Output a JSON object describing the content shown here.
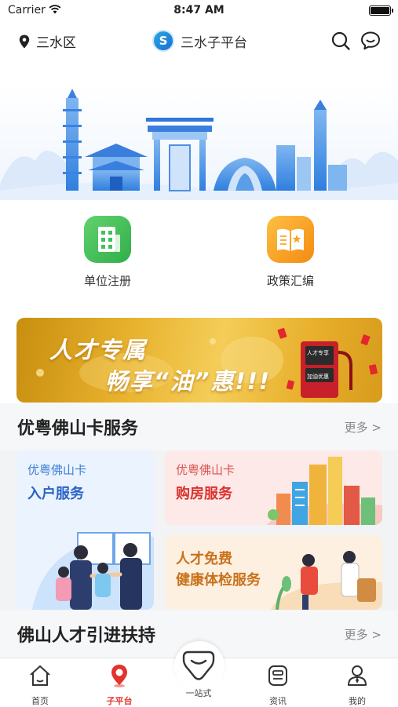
{
  "status_bar": {
    "carrier": "Carrier",
    "time": "8:47 AM"
  },
  "nav": {
    "location": "三水区",
    "platform_title": "三水子平台",
    "platform_logo_glyph": "S"
  },
  "entries": [
    {
      "label": "单位注册",
      "icon": "building-icon",
      "color": "#3ec15a"
    },
    {
      "label": "政策汇编",
      "icon": "book-icon",
      "color": "#f7a21e"
    }
  ],
  "promo": {
    "line1": "人才专属",
    "line2": "畅享“油”惠!!!",
    "sign_line1": "人才专享",
    "sign_line2": "加油优惠"
  },
  "section1": {
    "title": "优粤佛山卡服务",
    "more": "更多 >",
    "cards": [
      {
        "sub": "优粤佛山卡",
        "main": "入户服务",
        "color": "#2a64c5"
      },
      {
        "sub": "优粤佛山卡",
        "main": "购房服务",
        "color": "#d9322f"
      },
      {
        "line1": "人才免费",
        "line2": "健康体检服务",
        "color": "#c9711a"
      }
    ]
  },
  "section2": {
    "title": "佛山人才引进扶持",
    "more": "更多 >"
  },
  "tabs": [
    {
      "label": "首页",
      "icon": "home-icon"
    },
    {
      "label": "子平台",
      "icon": "location-pin-icon",
      "active": true
    },
    {
      "label": "一站式",
      "icon": "shield-icon"
    },
    {
      "label": "资讯",
      "icon": "news-icon"
    },
    {
      "label": "我的",
      "icon": "user-icon"
    }
  ],
  "colors": {
    "accent": "#e3332d",
    "brand_blue": "#2a8be6",
    "card_blue_bg": "#eaf3fe",
    "card_pink_bg": "#fde9e7",
    "card_orange_bg": "#fdf0e0"
  }
}
